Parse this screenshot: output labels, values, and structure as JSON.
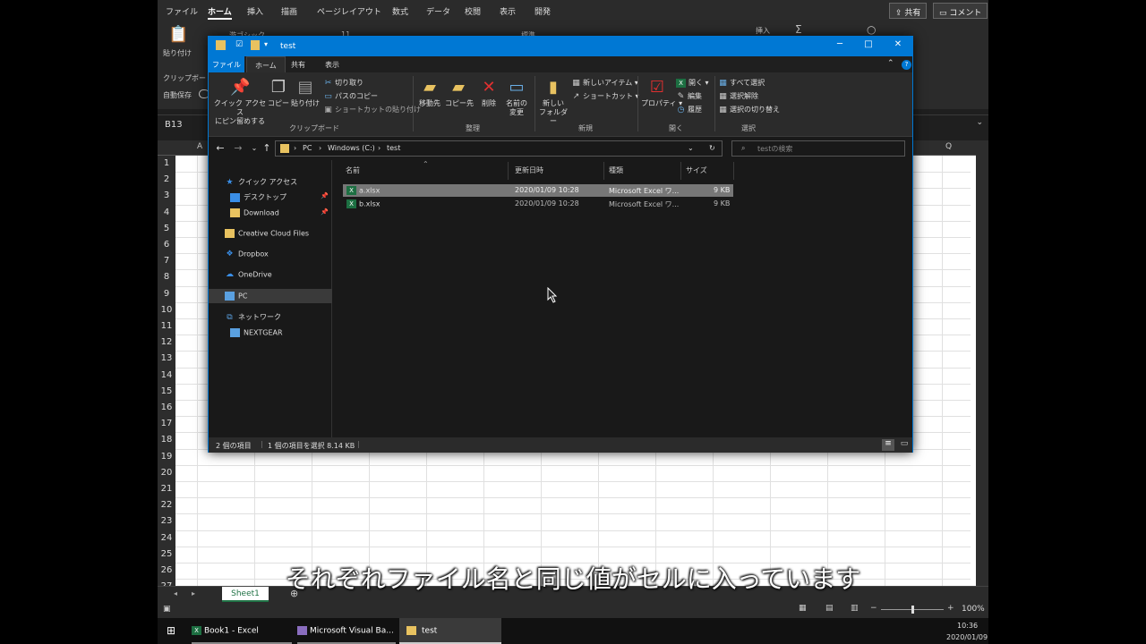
{
  "excel": {
    "tabs": [
      "ファイル",
      "ホーム",
      "挿入",
      "描画",
      "ページレイアウト",
      "数式",
      "データ",
      "校閲",
      "表示",
      "開発"
    ],
    "share_label": "共有",
    "comment_label": "コメント",
    "ribbon": {
      "paste": "貼り付け",
      "clipboard": "クリップボード",
      "autosave": "自動保存",
      "font_name": "游ゴシック",
      "font_size": "11",
      "number_format": "標準",
      "insert": "挿入"
    },
    "name_box": "B13",
    "columns": [
      "A",
      "Q"
    ],
    "rows": [
      "1",
      "2",
      "3",
      "4",
      "5",
      "6",
      "7",
      "8",
      "9",
      "10",
      "11",
      "12",
      "13",
      "14",
      "15",
      "16",
      "17",
      "18",
      "19",
      "20",
      "21",
      "22",
      "23",
      "24",
      "25",
      "26",
      "27"
    ],
    "sheet_tab": "Sheet1",
    "zoom": "100%"
  },
  "taskbar": {
    "items": [
      "Book1 - Excel",
      "Microsoft Visual Ba...",
      "test"
    ],
    "time": "10:36",
    "date": "2020/01/09"
  },
  "explorer": {
    "title": "test",
    "tabs": [
      "ファイル",
      "ホーム",
      "共有",
      "表示"
    ],
    "ribbon": {
      "quick_access": "クイック アクセス\nにピン留めする",
      "copy": "コピー",
      "paste": "貼り付け",
      "cut": "切り取り",
      "copy_path": "パスのコピー",
      "paste_shortcut": "ショートカットの貼り付け",
      "group_clipboard": "クリップボード",
      "move_to": "移動先",
      "copy_to": "コピー先",
      "delete": "削除",
      "rename": "名前の\n変更",
      "group_organize": "整理",
      "new_folder": "新しい\nフォルダー",
      "new_item": "新しいアイテム",
      "shortcut": "ショートカット",
      "group_new": "新規",
      "properties": "プロパティ",
      "open": "開く",
      "edit": "編集",
      "history": "履歴",
      "group_open": "開く",
      "select_all": "すべて選択",
      "select_none": "選択解除",
      "invert_selection": "選択の切り替え",
      "group_select": "選択"
    },
    "breadcrumb": [
      "PC",
      "Windows (C:)",
      "test"
    ],
    "search_placeholder": "testの検索",
    "nav": [
      {
        "label": "クイック アクセス",
        "icon": "star-icon"
      },
      {
        "label": "デスクトップ",
        "icon": "desktop-icon",
        "pinned": true
      },
      {
        "label": "Download",
        "icon": "folder-icon",
        "pinned": true
      },
      {
        "label": "Creative Cloud Files",
        "icon": "creative-cloud-icon"
      },
      {
        "label": "Dropbox",
        "icon": "dropbox-icon"
      },
      {
        "label": "OneDrive",
        "icon": "cloud-icon"
      },
      {
        "label": "PC",
        "icon": "pc-icon",
        "selected": true
      },
      {
        "label": "ネットワーク",
        "icon": "network-icon"
      },
      {
        "label": "NEXTGEAR",
        "icon": "computer-icon"
      }
    ],
    "columns": [
      "名前",
      "更新日時",
      "種類",
      "サイズ"
    ],
    "files": [
      {
        "name": "a.xlsx",
        "date": "2020/01/09 10:28",
        "type": "Microsoft Excel ワ...",
        "size": "9 KB",
        "selected": true
      },
      {
        "name": "b.xlsx",
        "date": "2020/01/09 10:28",
        "type": "Microsoft Excel ワ...",
        "size": "9 KB",
        "selected": false
      }
    ],
    "status": {
      "count": "2 個の項目",
      "selection": "1 個の項目を選択  8.14 KB"
    }
  },
  "subtitle": "それぞれファイル名と同じ値がセルに入っています",
  "colors": {
    "accent": "#0078d4",
    "excel_green": "#217346"
  }
}
